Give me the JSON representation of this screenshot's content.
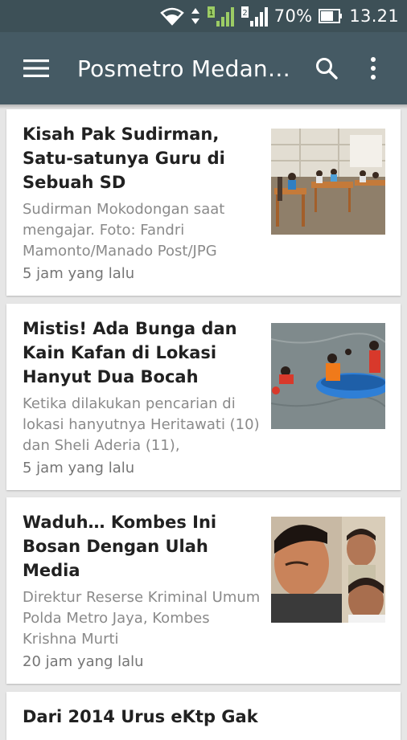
{
  "status_bar": {
    "battery_percent": "70%",
    "time": "13.21",
    "network_label": "2"
  },
  "app_bar": {
    "title": "Posmetro Medan…",
    "menu_icon": "hamburger-menu-icon",
    "search_icon": "search-icon",
    "more_icon": "more-vert-icon"
  },
  "colors": {
    "status_bar": "#3d5057",
    "app_bar": "#455a64",
    "background": "#e6e6e6",
    "card": "#ffffff",
    "headline": "#212121",
    "summary": "#8a8a8a"
  },
  "articles": [
    {
      "headline": "Kisah Pak Sudirman, Satu-satunya Guru di Sebuah SD",
      "summary": "Sudirman Mokodongan saat mengajar. Foto: Fandri Mamonto/Manado Post/JPG",
      "time": "5 jam yang lalu",
      "image": "classroom-photo"
    },
    {
      "headline": "Mistis! Ada Bunga dan Kain Kafan di Lokasi Hanyut Dua Bocah",
      "summary": "Ketika dilakukan pencarian di lokasi hanyutnya Heritawati (10) dan Sheli Aderia (11),",
      "time": "5 jam yang lalu",
      "image": "river-rescue-photo"
    },
    {
      "headline": "Waduh… Kombes Ini Bosan Dengan Ulah Media",
      "summary": "Direktur Reserse Kriminal Umum Polda Metro Jaya, Kombes Krishna Murti",
      "time": "20 jam yang lalu",
      "image": "police-officer-photo"
    },
    {
      "headline": "Dari 2014 Urus eKtp Gak",
      "image": "text-screenshot-photo"
    }
  ]
}
